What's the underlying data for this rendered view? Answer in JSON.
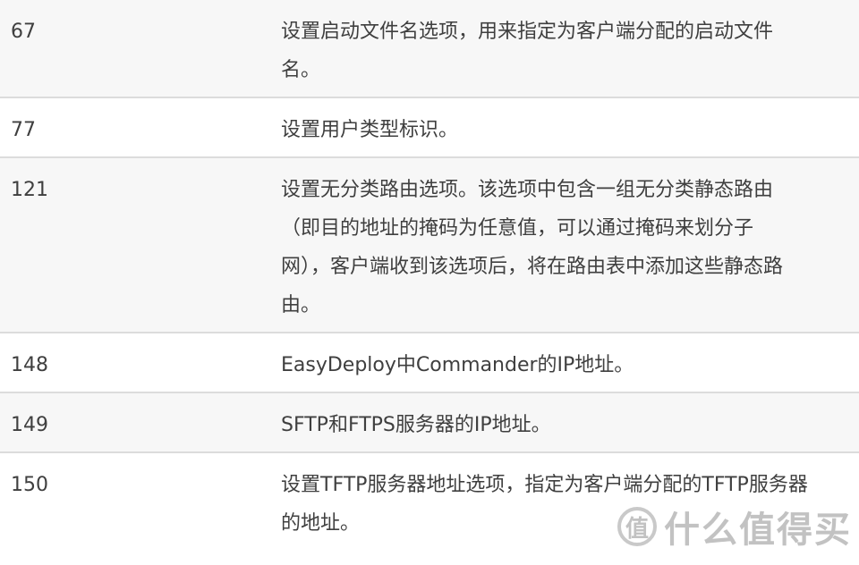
{
  "rows": [
    {
      "code": "67",
      "lines": [
        "设置启动文件名选项，用来指定为客户端分配的启动文件",
        "名。"
      ],
      "shaded": true
    },
    {
      "code": "77",
      "lines": [
        "设置用户类型标识。"
      ],
      "shaded": false
    },
    {
      "code": "121",
      "lines": [
        "设置无分类路由选项。该选项中包含一组无分类静态路由",
        "（即目的地址的掩码为任意值，可以通过掩码来划分子",
        "网），客户端收到该选项后，将在路由表中添加这些静态路",
        "由。"
      ],
      "shaded": true
    },
    {
      "code": "148",
      "lines": [
        "EasyDeploy中Commander的IP地址。"
      ],
      "shaded": false
    },
    {
      "code": "149",
      "lines": [
        "SFTP和FTPS服务器的IP地址。"
      ],
      "shaded": true
    },
    {
      "code": "150",
      "lines": [
        "设置TFTP服务器地址选项，指定为客户端分配的TFTP服务器",
        "的地址。"
      ],
      "shaded": false
    }
  ],
  "watermark": {
    "logo": "值",
    "text": "什么值得买"
  }
}
